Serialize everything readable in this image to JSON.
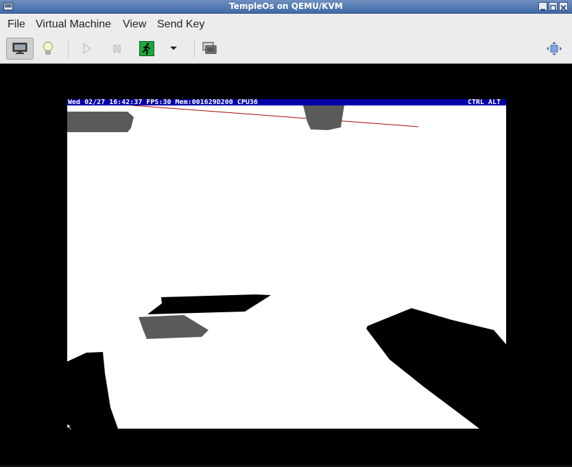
{
  "window": {
    "title": "TempleOs on QEMU/KVM"
  },
  "menubar": {
    "items": [
      {
        "label": "File"
      },
      {
        "label": "Virtual Machine"
      },
      {
        "label": "View"
      },
      {
        "label": "Send Key"
      }
    ]
  },
  "toolbar": {
    "buttons": [
      {
        "icon": "monitor-icon",
        "state": "pressed"
      },
      {
        "icon": "lightbulb-icon",
        "state": "normal"
      },
      {
        "icon": "play-icon",
        "state": "disabled"
      },
      {
        "icon": "pause-icon",
        "state": "disabled"
      },
      {
        "icon": "running-man-icon",
        "state": "normal"
      },
      {
        "icon": "chevron-down-icon",
        "state": "normal"
      },
      {
        "icon": "screenshot-icon",
        "state": "normal"
      },
      {
        "icon": "fullscreen-icon",
        "state": "normal"
      }
    ],
    "accent_green": "#1aa83a"
  },
  "guest": {
    "statusbar_left": "Wed 02/27 16:42:37 FPS:30 Mem:001629D200 CPU36",
    "statusbar_right": "CTRL ALT",
    "statusbar_color": "#0000aa",
    "colors": {
      "background": "#ffffff",
      "shadow": "#000000",
      "gray_object": "#5a5a5a",
      "line": "#aa0000"
    }
  }
}
